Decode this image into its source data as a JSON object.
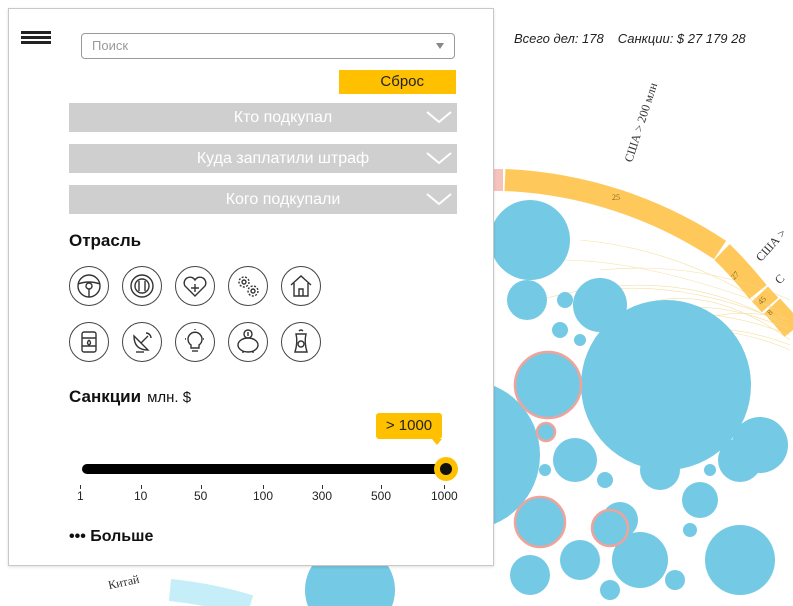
{
  "stats": {
    "cases": "Всего дел: 178",
    "sanctions": "Санкции: $ 27 179 28"
  },
  "ring_labels": {
    "usa_200": "США > 200 млн",
    "usa_right_1": "США >",
    "usa_right_2": "С",
    "china": "Китай",
    "n25": "25",
    "n27": "27",
    "n45": "45",
    "n8": "8"
  },
  "panel": {
    "search": {
      "placeholder": "Поиск"
    },
    "reset": "Сброс",
    "dropdowns": [
      "Кто подкупал",
      "Куда заплатили штраф",
      "Кого подкупали"
    ],
    "industry_title": "Отрасль",
    "industry_icons": [
      "steering-wheel-icon",
      "plate-cutlery-icon",
      "heart-cross-icon",
      "gears-icon",
      "house-icon",
      "oil-barrel-icon",
      "satellite-dish-icon",
      "lightbulb-icon",
      "piggy-bank-icon",
      "power-plant-icon"
    ],
    "sanctions_title": "Санкции",
    "sanctions_unit": "млн. $",
    "slider": {
      "value_label": "> 1000",
      "ticks": [
        "1",
        "10",
        "50",
        "100",
        "300",
        "500",
        "1000"
      ],
      "selected": "1000"
    },
    "more": "••• Больше"
  },
  "colors": {
    "accent": "#ffc000",
    "bubble": "#74c9e4",
    "bubble_outline": "#f0a39a",
    "ring": "#ffc85a",
    "gray": "#cfcfcf"
  }
}
